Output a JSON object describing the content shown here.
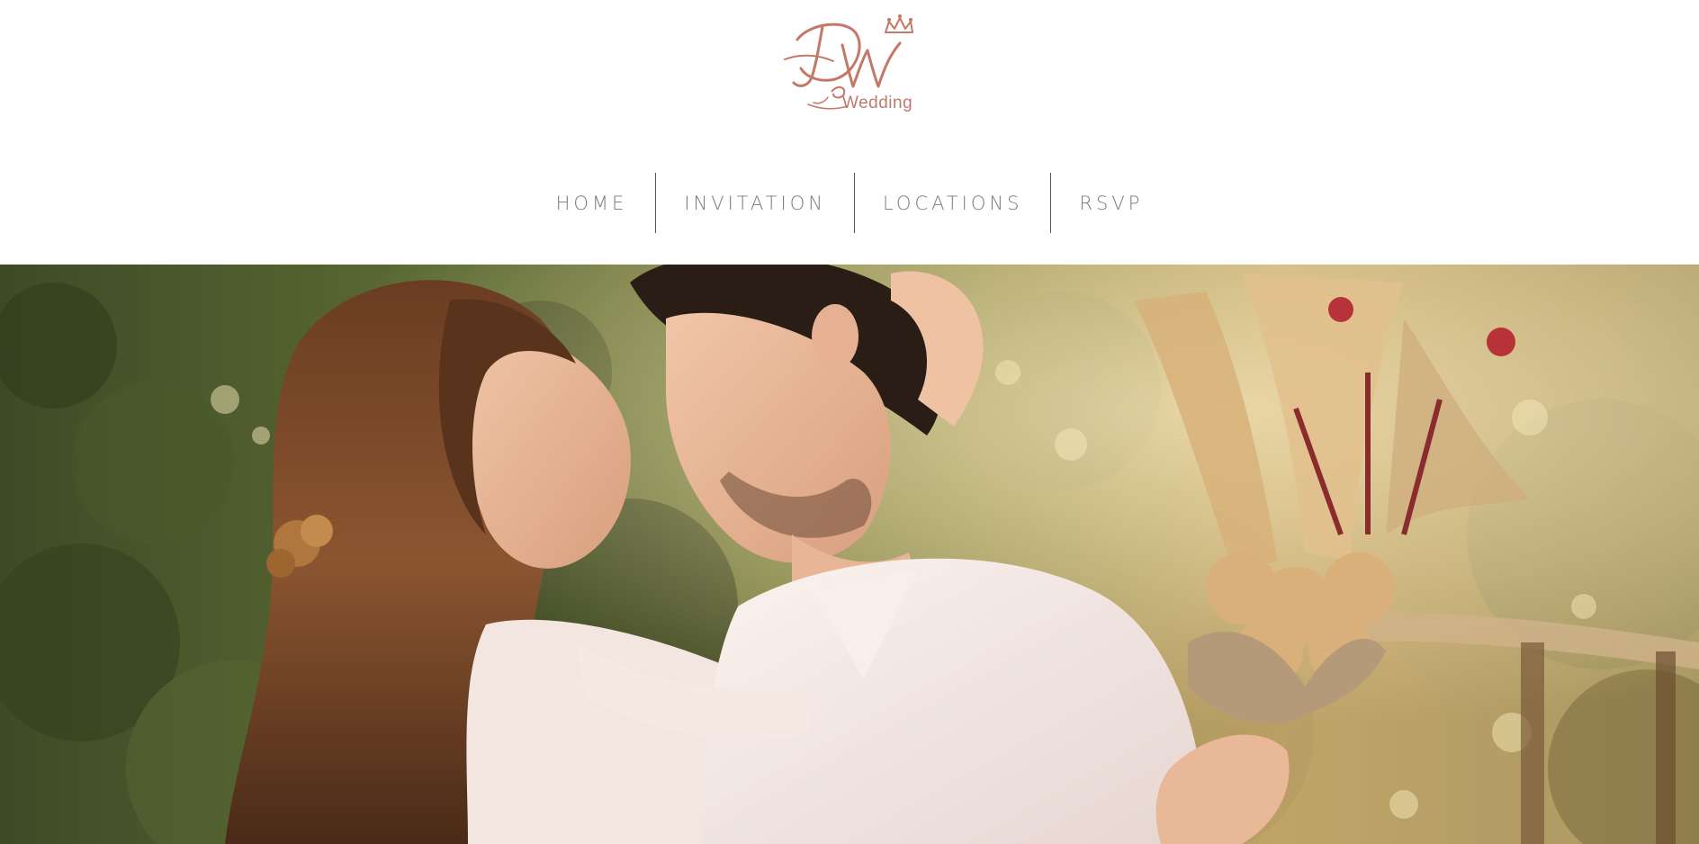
{
  "brand": {
    "logo_initials": "DW",
    "logo_text": "Wedding",
    "accent_color": "#c47867"
  },
  "nav": {
    "items": [
      {
        "label": "HOME"
      },
      {
        "label": "INVITATION"
      },
      {
        "label": "LOCATIONS"
      },
      {
        "label": "RSVP"
      }
    ]
  },
  "hero": {
    "image": "couple-embracing-photo"
  },
  "colors": {
    "nav_text": "#7a7a7a",
    "separator": "#555555",
    "background": "#ffffff"
  }
}
